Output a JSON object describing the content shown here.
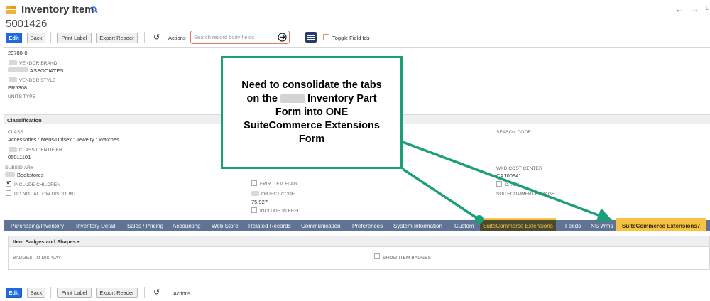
{
  "header": {
    "title": "Inventory Item",
    "record_id": "5001426",
    "nav_list_label": "Li"
  },
  "toolbar": {
    "edit": "Edit",
    "back": "Back",
    "print_label": "Print Label",
    "export_reader": "Export Reader",
    "actions": "Actions",
    "search_placeholder": "Search record body fields",
    "toggle_field_ids": "Toggle Field Ids"
  },
  "fields_top": {
    "first_value": "29780-0",
    "vendor_brand_label": "VENDOR BRAND",
    "vendor_brand_value": "ASSOCIATES",
    "vendor_style_label": "VENDOR STYLE",
    "vendor_style_value": "PR5308",
    "units_type_label": "UNITS TYPE"
  },
  "classification": {
    "section_title": "Classification",
    "class_label": "CLASS",
    "class_value": "Accessories : Mens/Unisex : Jewelry : Watches",
    "class_identifier_label": "CLASS IDENTIFIER",
    "class_identifier_value": "05011101",
    "subsidiary_label": "SUBSIDIARY",
    "subsidiary_value": "Bookstores",
    "include_children": "INCLUDE CHILDREN",
    "do_not_allow_discount": "DO NOT ALLOW DISCOUNT",
    "ewr_item_flag": "EWR ITEM FLAG",
    "object_code_label": "OBJECT CODE",
    "object_code_value": "75,927",
    "include_in_feed": "INCLUDE IN FEED",
    "season_code_label": "SEASON CODE",
    "wkd_cost_center_label": "WKD COST CENTER",
    "wkd_cost_center_value": "CA100941",
    "right_cb_label": "D...DN",
    "suitecommerce_image_label": "SUITECOMMERCE IMAGE"
  },
  "tabs": [
    {
      "label": "Purchasing/Inventory"
    },
    {
      "label": "Inventory Detail"
    },
    {
      "label": "Sales / Pricing"
    },
    {
      "label": "Accounting"
    },
    {
      "label": "Web Store"
    },
    {
      "label": "Related Records"
    },
    {
      "label": "Communication"
    },
    {
      "label": "Preferences"
    },
    {
      "label": "System Information"
    },
    {
      "label": "Custom"
    },
    {
      "label": "SuiteCommerce Extensions"
    },
    {
      "label": "Feeds"
    },
    {
      "label": "NS Wms"
    },
    {
      "label": "SuiteCommerce Extensions7"
    }
  ],
  "subsection": {
    "title": "Item Badges and Shapes",
    "badges_label": "BADGES TO DISPLAY",
    "show_badges_label": "SHOW ITEM BADGES"
  },
  "callout": {
    "line1": "Need to consolidate the tabs",
    "line2_pre": "on the",
    "line2_post": "Inventory Part",
    "line3": "Form into ONE",
    "line4": "SuiteCommerce Extensions",
    "line5": "Form"
  },
  "colors": {
    "primary_button": "#1f6ae0",
    "tab_bar": "#5f7394",
    "tab_highlight": "#f6c344",
    "callout_border": "#1b9e7a"
  }
}
